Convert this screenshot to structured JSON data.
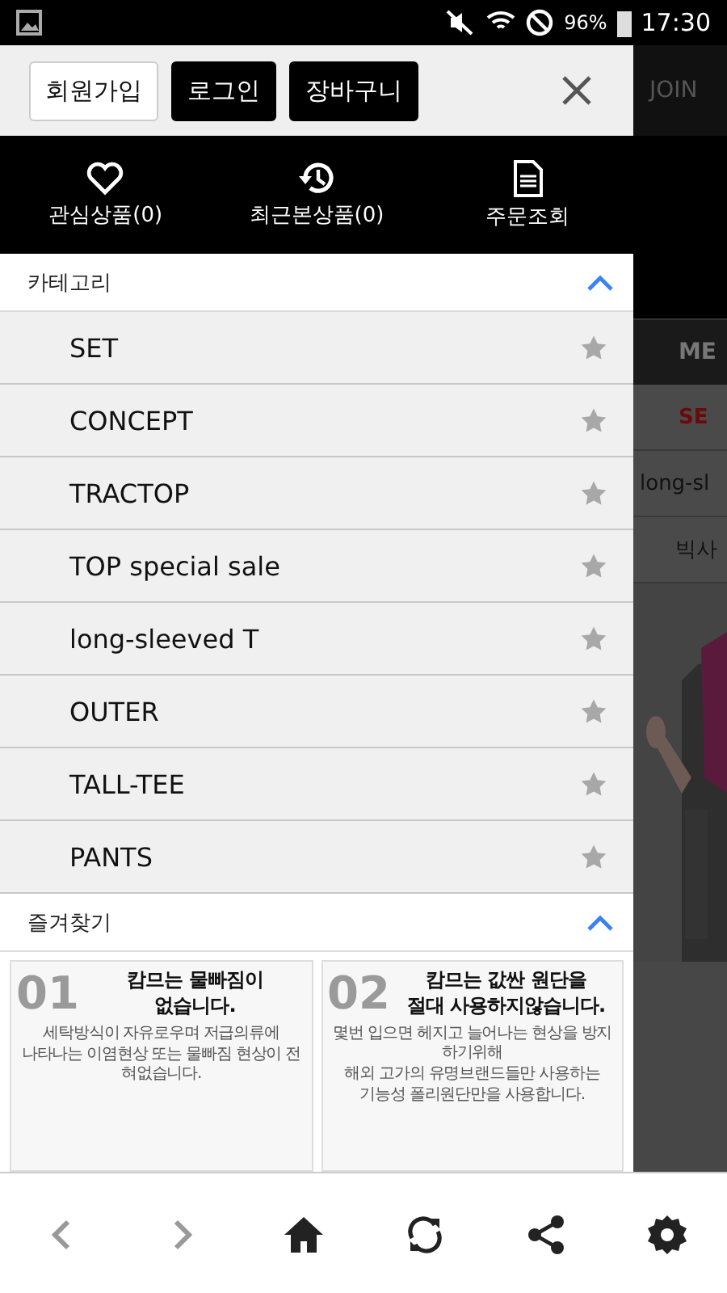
{
  "status_bar": {
    "battery": "96%",
    "time": "17:30"
  },
  "header_buttons": [
    {
      "label": "회원가입",
      "kind": "outline"
    },
    {
      "label": "로그인",
      "kind": "filled"
    },
    {
      "label": "장바구니",
      "kind": "filled"
    }
  ],
  "quick_links": [
    {
      "label": "관심상품(0)",
      "kind": "heart"
    },
    {
      "label": "최근본상품(0)",
      "kind": "history"
    },
    {
      "label": "주문조회",
      "kind": "document"
    }
  ],
  "category": {
    "title": "카테고리",
    "expanded": true,
    "items": [
      "SET",
      "CONCEPT",
      "TRACTOP",
      "TOP special sale",
      "long-sleeved T",
      "OUTER",
      "TALL-TEE",
      "PANTS"
    ]
  },
  "favorites": {
    "title": "즐겨찾기",
    "expanded": true,
    "banners": [
      {
        "number": "01",
        "title": "캄므는 물빠짐이\n없습니다.",
        "lines": [
          "세탁방식이 자유로우며 저급의류에",
          "나타나는 이염현상 또는 물빠짐 현상이 전혀없습니다."
        ]
      },
      {
        "number": "02",
        "title": "캄므는 값싼 원단을\n절대 사용하지않습니다.",
        "lines": [
          "몇번 입으면 헤지고 늘어나는 현상을 방지하기위해",
          "해외 고가의 유명브랜드들만 사용하는",
          "기능성 폴리원단만을 사용합니다."
        ]
      }
    ]
  },
  "background_page": {
    "join": "JOIN",
    "tab": "ME",
    "links": [
      {
        "label": "SE",
        "kind": "accent"
      },
      {
        "label": "long-sl",
        "kind": "plain"
      },
      {
        "label": "빅사",
        "kind": "plain"
      }
    ]
  }
}
